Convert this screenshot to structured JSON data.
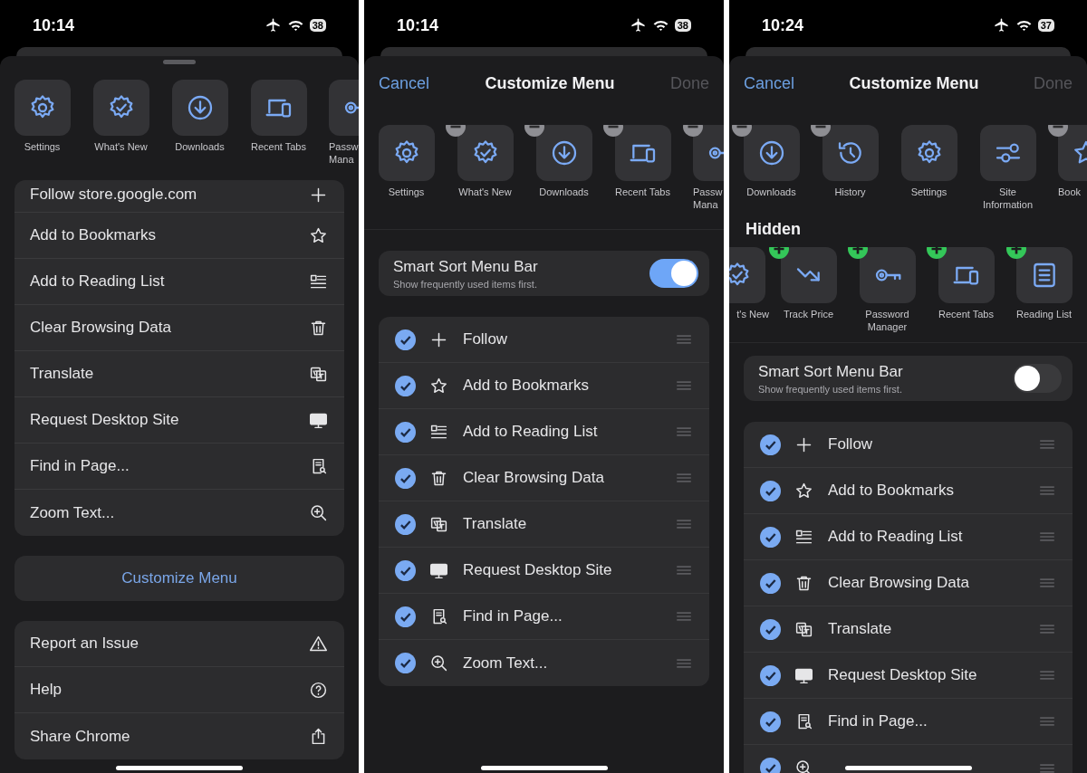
{
  "panels": [
    {
      "kind": "menu",
      "status": {
        "time": "10:14",
        "battery": "38"
      },
      "actions": [
        {
          "label": "Settings",
          "kind": "settings"
        },
        {
          "label": "What's New",
          "kind": "whats_new"
        },
        {
          "label": "Downloads",
          "kind": "downloads"
        },
        {
          "label": "Recent Tabs",
          "kind": "recent_tabs"
        },
        {
          "label": "Passw\nMana",
          "kind": "passwords"
        }
      ],
      "items": [
        {
          "label": "Follow store.google.com",
          "kind": "follow"
        },
        {
          "label": "Add to Bookmarks",
          "kind": "bookmark"
        },
        {
          "label": "Add to Reading List",
          "kind": "reading_list"
        },
        {
          "label": "Clear Browsing Data",
          "kind": "clear_data"
        },
        {
          "label": "Translate",
          "kind": "translate"
        },
        {
          "label": "Request Desktop Site",
          "kind": "desktop"
        },
        {
          "label": "Find in Page...",
          "kind": "find"
        },
        {
          "label": "Zoom Text...",
          "kind": "zoom"
        }
      ],
      "customize_button": "Customize Menu",
      "footer_items": [
        {
          "label": "Report an Issue",
          "kind": "report"
        },
        {
          "label": "Help",
          "kind": "help"
        },
        {
          "label": "Share Chrome",
          "kind": "share"
        }
      ]
    },
    {
      "kind": "customize",
      "status": {
        "time": "10:14",
        "battery": "38"
      },
      "cancel": "Cancel",
      "title": "Customize Menu",
      "done": {
        "label": "Done",
        "disabled": true
      },
      "actions": [
        {
          "label": "Settings",
          "kind": "settings",
          "removable": false
        },
        {
          "label": "What's New",
          "kind": "whats_new",
          "removable": true
        },
        {
          "label": "Downloads",
          "kind": "downloads",
          "removable": true
        },
        {
          "label": "Recent Tabs",
          "kind": "recent_tabs",
          "removable": true
        },
        {
          "label": "Passw\nMana",
          "kind": "passwords",
          "removable": true
        }
      ],
      "smart_sort": {
        "title": "Smart Sort Menu Bar",
        "subtitle": "Show frequently used items first.",
        "on": true
      },
      "items": [
        {
          "label": "Follow",
          "kind": "follow",
          "checked": true
        },
        {
          "label": "Add to Bookmarks",
          "kind": "bookmark",
          "checked": true
        },
        {
          "label": "Add to Reading List",
          "kind": "reading_list",
          "checked": true
        },
        {
          "label": "Clear Browsing Data",
          "kind": "clear_data",
          "checked": true
        },
        {
          "label": "Translate",
          "kind": "translate",
          "checked": true
        },
        {
          "label": "Request Desktop Site",
          "kind": "desktop",
          "checked": true
        },
        {
          "label": "Find in Page...",
          "kind": "find",
          "checked": true
        },
        {
          "label": "Zoom Text...",
          "kind": "zoom",
          "checked": true
        }
      ]
    },
    {
      "kind": "customize",
      "status": {
        "time": "10:24",
        "battery": "37"
      },
      "cancel": "Cancel",
      "title": "Customize Menu",
      "done": {
        "label": "Done",
        "disabled": true
      },
      "actions": [
        {
          "label": "Downloads",
          "kind": "downloads",
          "removable": true
        },
        {
          "label": "History",
          "kind": "history",
          "removable": true
        },
        {
          "label": "Settings",
          "kind": "settings",
          "removable": false
        },
        {
          "label": "Site\nInformation",
          "kind": "site_info",
          "removable": false
        },
        {
          "label": "Book",
          "kind": "bookmark",
          "removable": true
        }
      ],
      "hidden_title": "Hidden",
      "hidden_actions": [
        {
          "label": "t's New",
          "kind": "whats_new",
          "addable": false
        },
        {
          "label": "Track Price",
          "kind": "track_price",
          "addable": true
        },
        {
          "label": "Password\nManager",
          "kind": "passwords",
          "addable": true
        },
        {
          "label": "Recent Tabs",
          "kind": "recent_tabs",
          "addable": true
        },
        {
          "label": "Reading List",
          "kind": "reading_list_tile",
          "addable": true
        }
      ],
      "smart_sort": {
        "title": "Smart Sort Menu Bar",
        "subtitle": "Show frequently used items first.",
        "on": false
      },
      "items": [
        {
          "label": "Follow",
          "kind": "follow",
          "checked": true
        },
        {
          "label": "Add to Bookmarks",
          "kind": "bookmark",
          "checked": true
        },
        {
          "label": "Add to Reading List",
          "kind": "reading_list",
          "checked": true
        },
        {
          "label": "Clear Browsing Data",
          "kind": "clear_data",
          "checked": true
        },
        {
          "label": "Translate",
          "kind": "translate",
          "checked": true
        },
        {
          "label": "Request Desktop Site",
          "kind": "desktop",
          "checked": true
        },
        {
          "label": "Find in Page...",
          "kind": "find",
          "checked": true
        },
        {
          "kind": "zoom",
          "checked": true
        }
      ]
    }
  ]
}
